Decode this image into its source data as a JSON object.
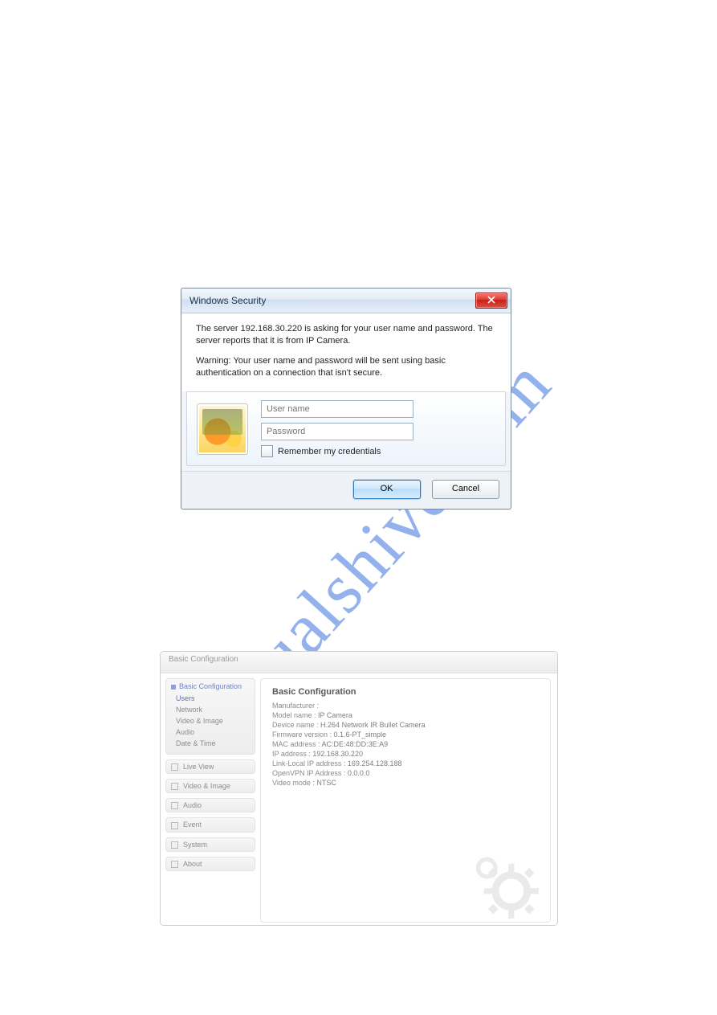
{
  "watermark": "manualshive.com",
  "dialog": {
    "title": "Windows Security",
    "msg1a": "The server 192.168.30.220 is asking for your user name and password. The server reports that it is from ",
    "msg1b": "IP Camera",
    "msg1c": ".",
    "msg2": "Warning: Your user name and password will be sent using basic authentication on a connection that isn't secure.",
    "username_placeholder": "User name",
    "password_placeholder": "Password",
    "remember_label": "Remember my credentials",
    "ok_label": "OK",
    "cancel_label": "Cancel"
  },
  "config": {
    "topbar": "Basic Configuration",
    "sidebar": {
      "expanded_title": "Basic Configuration",
      "expanded_items": [
        "Users",
        "Network",
        "Video & Image",
        "Audio",
        "Date & Time"
      ],
      "collapsed_items": [
        "Live View",
        "Video & Image",
        "Audio",
        "Event",
        "System",
        "About"
      ]
    },
    "main": {
      "heading": "Basic Configuration",
      "rows": [
        {
          "label": "Manufacturer",
          "value": ""
        },
        {
          "label": "Model name",
          "value": "IP Camera"
        },
        {
          "label": "Device name",
          "value": "H.264 Network IR Bullet Camera"
        },
        {
          "label": "Firmware version",
          "value": "0.1.6-PT_simple"
        },
        {
          "label": "MAC address",
          "value": "AC:DE:48:DD:3E:A9"
        },
        {
          "label": "IP address",
          "value": "192.168.30.220"
        },
        {
          "label": "Link-Local IP address",
          "value": "169.254.128.188"
        },
        {
          "label": "OpenVPN IP Address",
          "value": "0.0.0.0"
        },
        {
          "label": "Video mode",
          "value": "NTSC"
        }
      ]
    }
  }
}
